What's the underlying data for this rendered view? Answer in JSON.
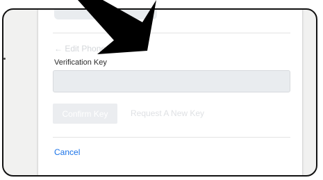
{
  "form": {
    "back_link": "← Edit Phone",
    "field_label": "Verification Key",
    "field_value": "",
    "confirm_label": "Confirm Key",
    "request_label": "Request A New Key",
    "cancel_label": "Cancel"
  },
  "colors": {
    "link": "#1a73e8",
    "disabled_button": "#ebedf0",
    "input_background": "#e9ecef",
    "frame_border": "#111111",
    "arrow": "#000000"
  },
  "icons": {
    "pointer": "pointer-arrow-icon"
  }
}
